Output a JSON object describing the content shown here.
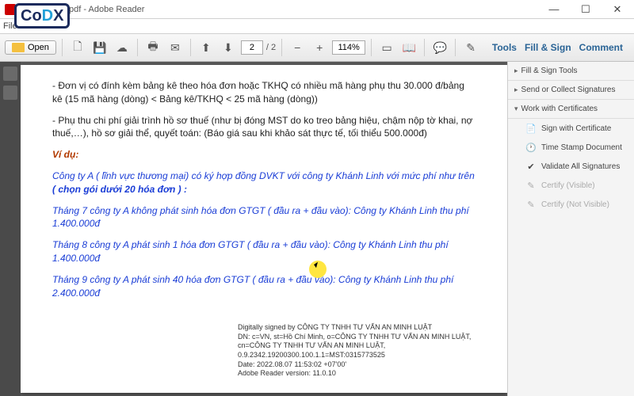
{
  "window": {
    "title": ".pdf - Adobe Reader"
  },
  "menu": {
    "file": "File",
    "open": "Open"
  },
  "toolbar": {
    "page_current": "2",
    "page_total": "/ 2",
    "zoom": "114%"
  },
  "rightlinks": {
    "tools": "Tools",
    "fillsign": "Fill & Sign",
    "comment": "Comment"
  },
  "doc": {
    "p1": "- Đơn vị có đính kèm bảng kê theo hóa đơn hoặc TKHQ có nhiều mã hàng phụ thu 30.000 đ/bảng kê  (15 mã hàng (dòng) < Bảng kê/TKHQ < 25 mã hàng (dòng))",
    "p2": "- Phụ thu chi phí giải trình hồ sơ thuế (như bị đóng MST do ko treo bảng hiệu, chậm nộp tờ khai, nợ thuế,…), hồ sơ giải thể, quyết toán: (Báo giá sau khi khảo sát thực tế, tối thiểu 500.000đ)",
    "vd": "Ví dụ:",
    "b1a": "Công ty A ( lĩnh vực thương mại) có ký hợp đồng DVKT với công ty Khánh Linh với mức phí như trên ",
    "b1b": "( chọn gói dưới 20 hóa đơn ) :",
    "b2": "Tháng 7 công ty A không phát sinh hóa đơn GTGT ( đầu ra + đầu vào): Công ty Khánh Linh thu phí 1.400.000đ",
    "b3": "Tháng 8 công ty A phát sinh 1 hóa đơn GTGT ( đầu ra + đầu vào): Công ty Khánh Linh thu phí 1.400.000đ",
    "b4": "Tháng 9 công ty A phát sinh 40 hóa đơn GTGT ( đầu ra + đầu vào): Công ty Khánh Linh thu phí 2.400.000đ"
  },
  "sig": {
    "l1": "Digitally signed by CÔNG TY TNHH TƯ VẤN AN MINH LUẬT",
    "l2": "DN: c=VN, st=Hồ Chí Minh, o=CÔNG TY TNHH TƯ VẤN AN MINH LUẬT, cn=CÔNG TY TNHH TƯ VẤN AN MINH LUẬT, 0.9.2342.19200300.100.1.1=MST:0315773525",
    "l3": "Date: 2022.08.07 11:53:02 +07'00'",
    "l4": "Adobe Reader version: 11.0.10"
  },
  "panel": {
    "s1": "Fill & Sign Tools",
    "s2": "Send or Collect Signatures",
    "s3": "Work with Certificates",
    "i1": "Sign with Certificate",
    "i2": "Time Stamp Document",
    "i3": "Validate All Signatures",
    "i4": "Certify (Visible)",
    "i5": "Certify (Not Visible)"
  },
  "logo": {
    "co": "Co",
    "d": "D",
    "x": "X"
  }
}
